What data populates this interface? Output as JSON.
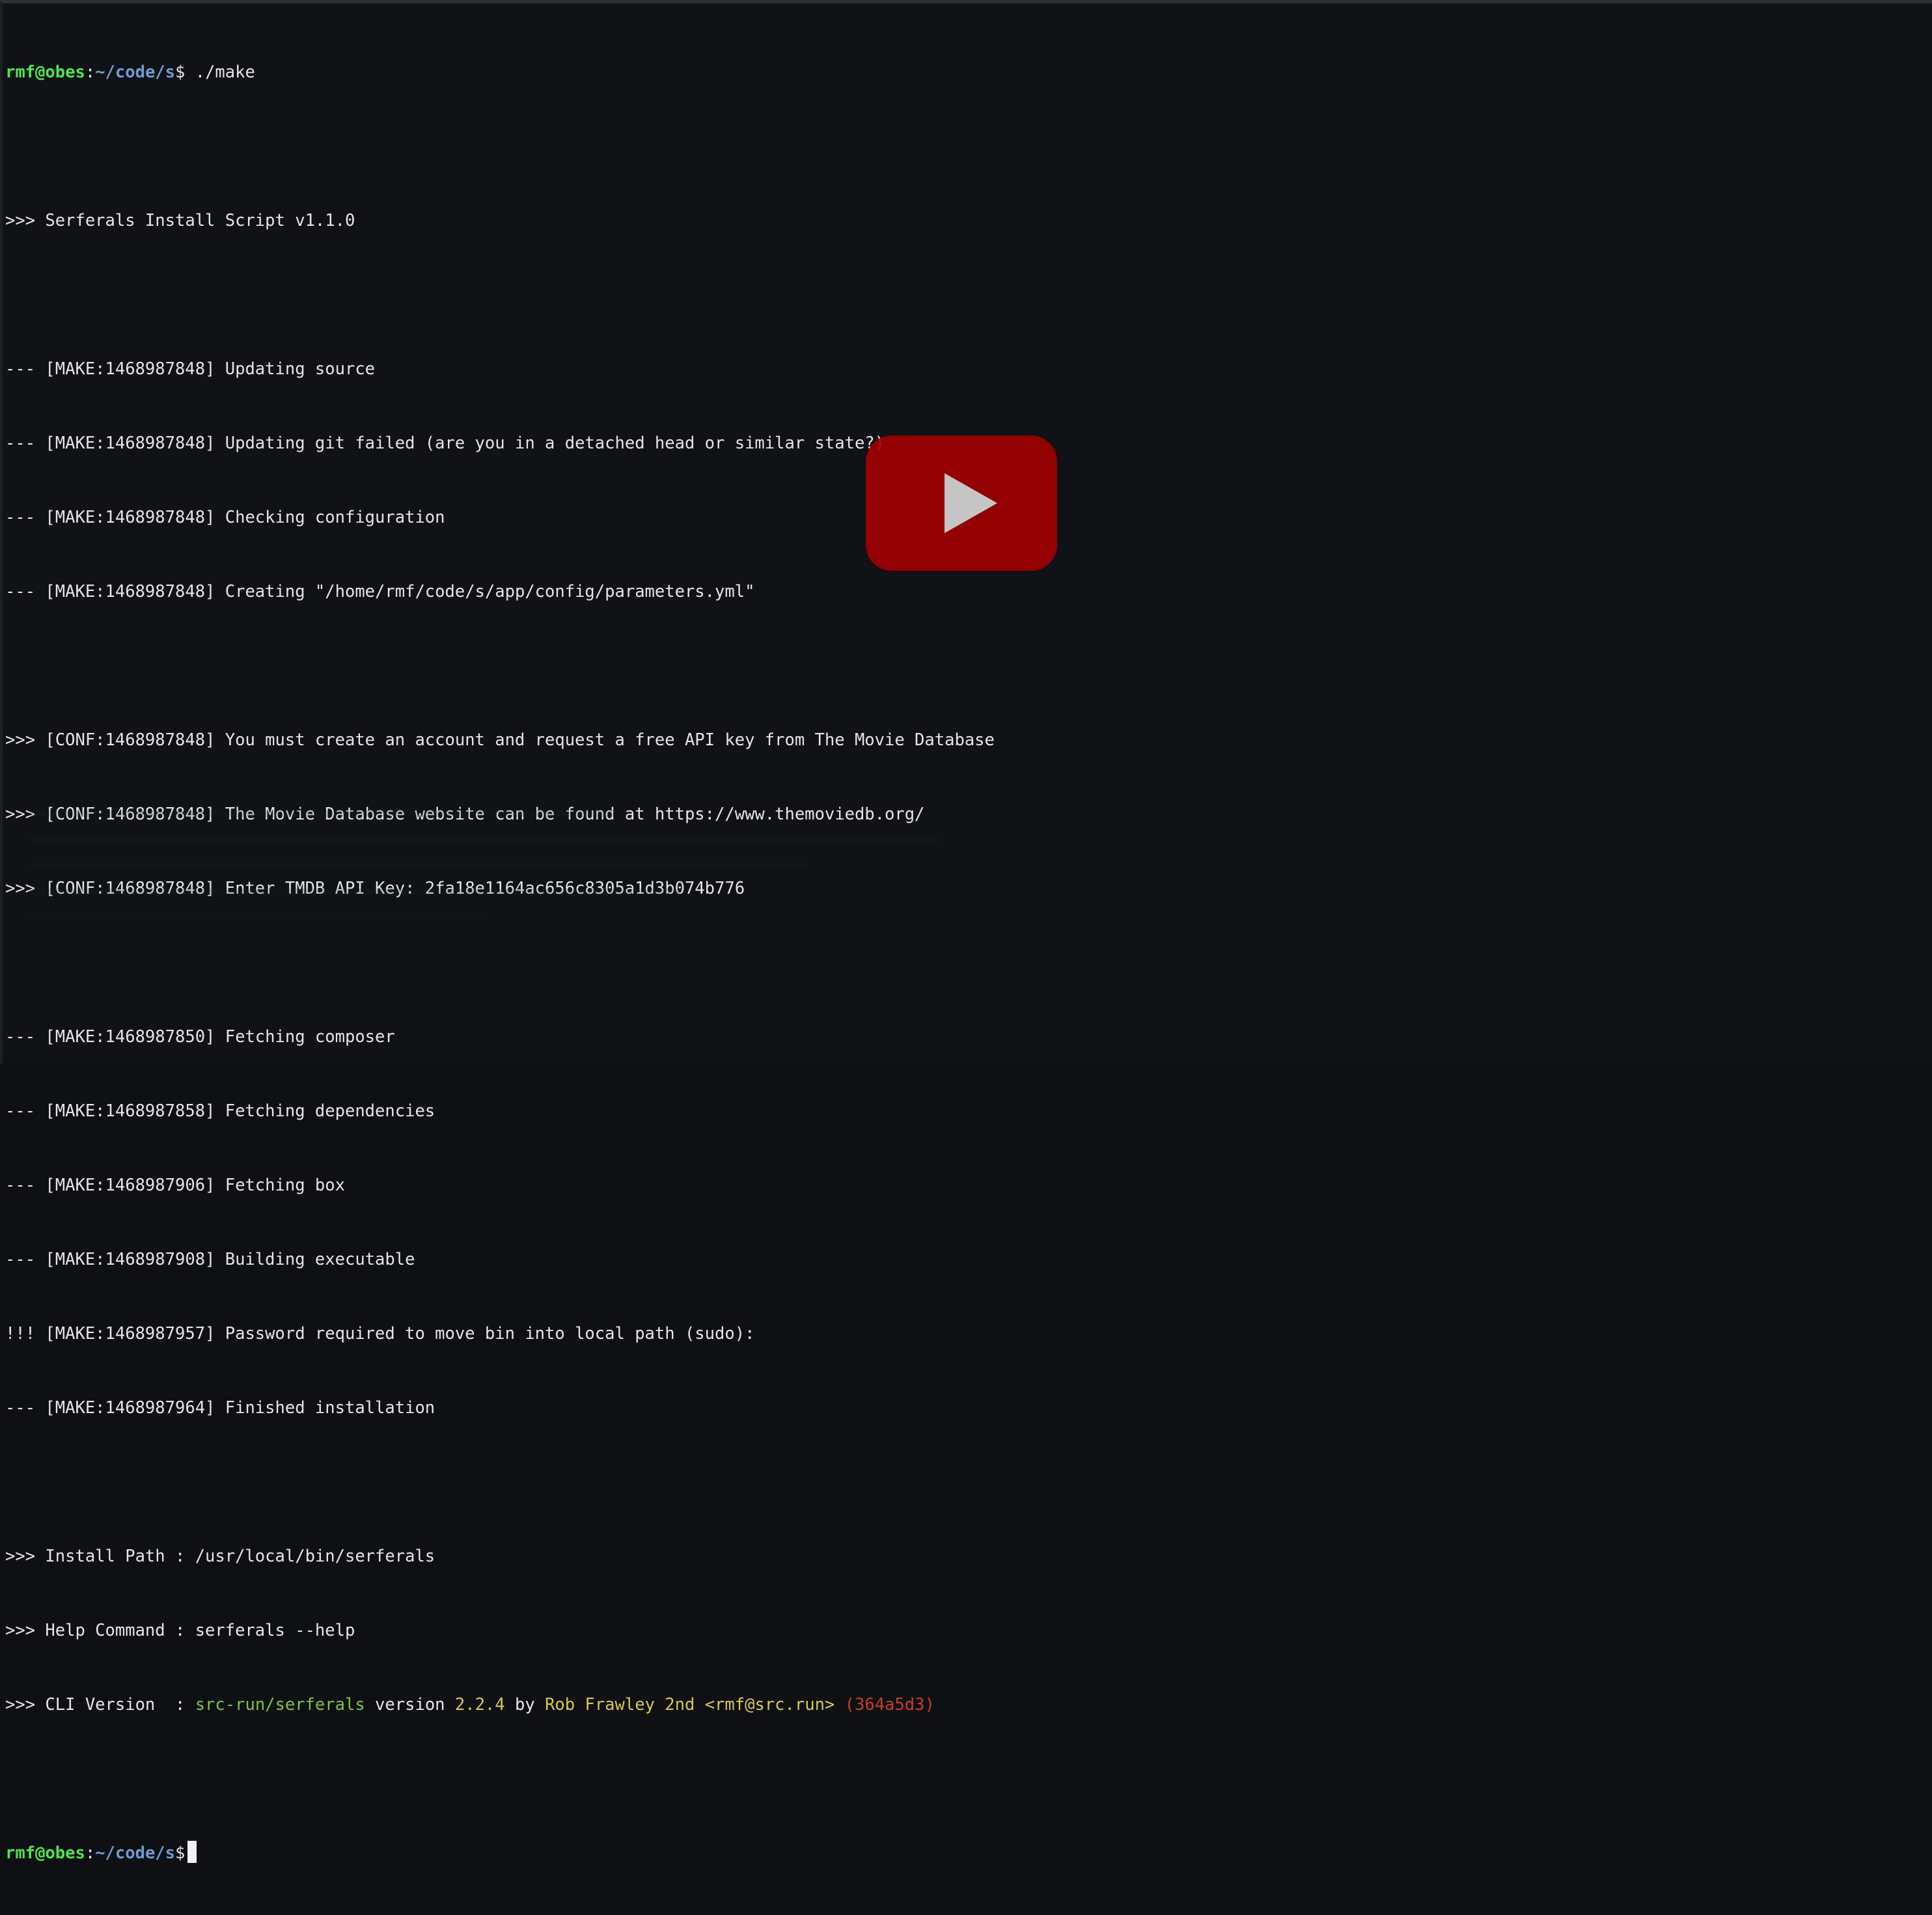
{
  "prompt": {
    "user_host": "rmf@obes",
    "path": "~/code/s",
    "symbol": "$",
    "command": " ./make"
  },
  "lines": [
    ">>> Serferals Install Script v1.1.0",
    "--- [MAKE:1468987848] Updating source",
    "--- [MAKE:1468987848] Updating git failed (are you in a detached head or similar state?)",
    "--- [MAKE:1468987848] Checking configuration",
    "--- [MAKE:1468987848] Creating \"/home/rmf/code/s/app/config/parameters.yml\"",
    ">>> [CONF:1468987848] You must create an account and request a free API key from The Movie Database",
    ">>> [CONF:1468987848] The Movie Database website can be found at https://www.themoviedb.org/",
    ">>> [CONF:1468987848] Enter TMDB API Key: 2fa18e1164ac656c8305a1d3b074b776",
    "--- [MAKE:1468987850] Fetching composer",
    "--- [MAKE:1468987858] Fetching dependencies",
    "--- [MAKE:1468987906] Fetching box",
    "--- [MAKE:1468987908] Building executable",
    "!!! [MAKE:1468987957] Password required to move bin into local path (sudo):",
    "--- [MAKE:1468987964] Finished installation",
    ">>> Install Path : /usr/local/bin/serferals",
    ">>> Help Command : serferals --help"
  ],
  "cli_version": {
    "prefix": ">>> CLI Version  : ",
    "repo": "src-run/serferals",
    "version_word": " version ",
    "version": "2.2.4",
    "by_word": " by ",
    "author": "Rob Frawley 2nd <rmf@src.run>",
    "hash": " (364a5d3)"
  },
  "colors": {
    "background": "#101216",
    "text": "#e6e6e6",
    "user": "#4ee64e",
    "path": "#6f9cd2",
    "repo": "#7ec240",
    "highlight": "#d6c94a",
    "hash": "#c83a2e",
    "play_button": "#a20000"
  },
  "overlay": {
    "icon": "play-icon"
  }
}
